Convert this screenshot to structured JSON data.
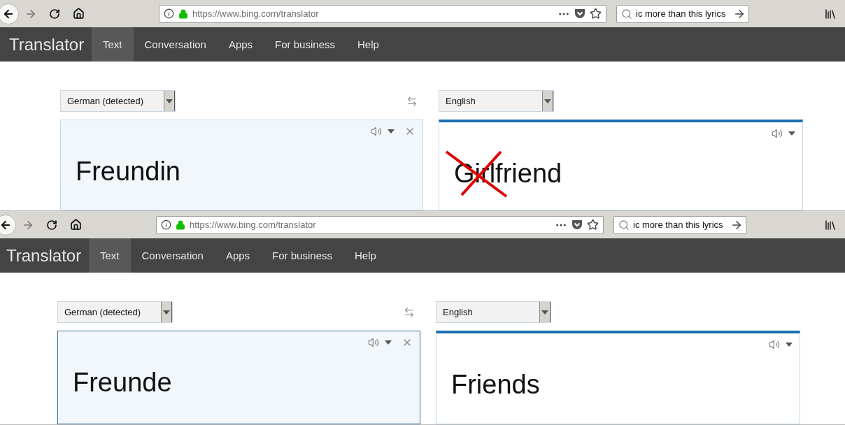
{
  "screenshots": [
    {
      "browser": {
        "url": "https://www.bing.com/translator",
        "search_value": "ic more than this lyrics"
      },
      "nav": {
        "brand": "Translator",
        "tabs": [
          {
            "label": "Text",
            "selected": true
          },
          {
            "label": "Conversation",
            "selected": false
          },
          {
            "label": "Apps",
            "selected": false
          },
          {
            "label": "For business",
            "selected": false
          },
          {
            "label": "Help",
            "selected": false
          }
        ]
      },
      "source": {
        "language": "German (detected)",
        "text": "Freundin",
        "focused": false
      },
      "target": {
        "language": "English",
        "text": "Girlfriend",
        "crossed_out": true
      }
    },
    {
      "browser": {
        "url": "https://www.bing.com/translator",
        "search_value": "ic more than this lyrics"
      },
      "nav": {
        "brand": "Translator",
        "tabs": [
          {
            "label": "Text",
            "selected": true
          },
          {
            "label": "Conversation",
            "selected": false
          },
          {
            "label": "Apps",
            "selected": false
          },
          {
            "label": "For business",
            "selected": false
          },
          {
            "label": "Help",
            "selected": false
          }
        ]
      },
      "source": {
        "language": "German (detected)",
        "text": "Freunde",
        "focused": true
      },
      "target": {
        "language": "English",
        "text": "Friends",
        "crossed_out": false
      }
    }
  ]
}
